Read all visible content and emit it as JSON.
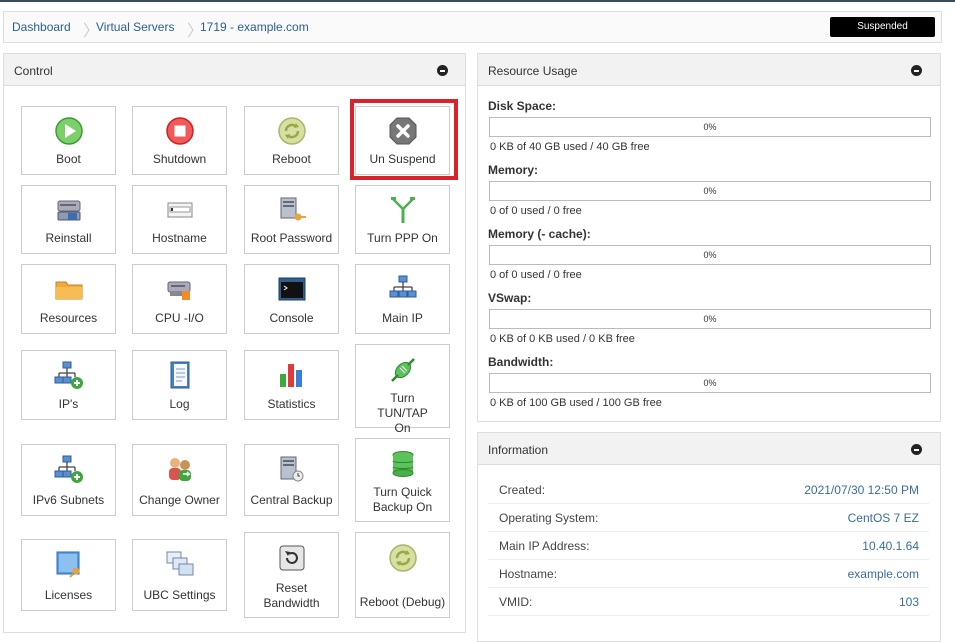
{
  "breadcrumb": {
    "items": [
      "Dashboard",
      "Virtual Servers",
      "1719 - example.com"
    ],
    "status": "Suspended"
  },
  "control": {
    "title": "Control",
    "tiles": [
      {
        "label": "Boot",
        "icon": "play-icon"
      },
      {
        "label": "Shutdown",
        "icon": "stop-icon"
      },
      {
        "label": "Reboot",
        "icon": "reboot-icon"
      },
      {
        "label": "Un Suspend",
        "icon": "unsuspend-icon"
      },
      {
        "label": "Reinstall",
        "icon": "reinstall-icon"
      },
      {
        "label": "Hostname",
        "icon": "hostname-icon"
      },
      {
        "label": "Root Password",
        "icon": "root-password-icon"
      },
      {
        "label": "Turn PPP On",
        "icon": "ppp-icon"
      },
      {
        "label": "Resources",
        "icon": "folder-icon"
      },
      {
        "label": "CPU -I/O",
        "icon": "cpu-icon"
      },
      {
        "label": "Console",
        "icon": "console-icon"
      },
      {
        "label": "Main IP",
        "icon": "network-icon"
      },
      {
        "label": "IP's",
        "icon": "add-network-icon"
      },
      {
        "label": "Log",
        "icon": "log-icon"
      },
      {
        "label": "Statistics",
        "icon": "statistics-icon"
      },
      {
        "label": "Turn TUN/TAP On",
        "icon": "tuntap-icon"
      },
      {
        "label": "IPv6 Subnets",
        "icon": "ipv6-icon"
      },
      {
        "label": "Change Owner",
        "icon": "change-owner-icon"
      },
      {
        "label": "Central Backup",
        "icon": "backup-icon"
      },
      {
        "label": "Turn Quick Backup On",
        "icon": "database-icon"
      },
      {
        "label": "Licenses",
        "icon": "license-icon"
      },
      {
        "label": "UBC Settings",
        "icon": "ubc-icon"
      },
      {
        "label": "Reset Bandwidth",
        "icon": "reset-icon"
      },
      {
        "label": "Reboot (Debug)",
        "icon": "reboot-debug-icon"
      }
    ]
  },
  "resource_usage": {
    "title": "Resource Usage",
    "items": [
      {
        "label": "Disk Space:",
        "percent": "0%",
        "detail": "0 KB of 40 GB used / 40 GB free"
      },
      {
        "label": "Memory:",
        "percent": "0%",
        "detail": "0 of 0 used / 0 free"
      },
      {
        "label": "Memory (- cache):",
        "percent": "0%",
        "detail": "0 of 0 used / 0 free"
      },
      {
        "label": "VSwap:",
        "percent": "0%",
        "detail": "0 KB of 0 KB used / 0 KB free"
      },
      {
        "label": "Bandwidth:",
        "percent": "0%",
        "detail": "0 KB of 100 GB used / 100 GB free"
      }
    ]
  },
  "information": {
    "title": "Information",
    "rows": [
      {
        "key": "Created:",
        "value": "2021/07/30 12:50 PM"
      },
      {
        "key": "Operating System:",
        "value": "CentOS 7 EZ"
      },
      {
        "key": "Main IP Address:",
        "value": "10.40.1.64"
      },
      {
        "key": "Hostname:",
        "value": "example.com"
      },
      {
        "key": "VMID:",
        "value": "103"
      }
    ]
  },
  "colors": {
    "accent": "#2a5f8f",
    "highlight": "#d8232a",
    "badge": "#000000"
  }
}
